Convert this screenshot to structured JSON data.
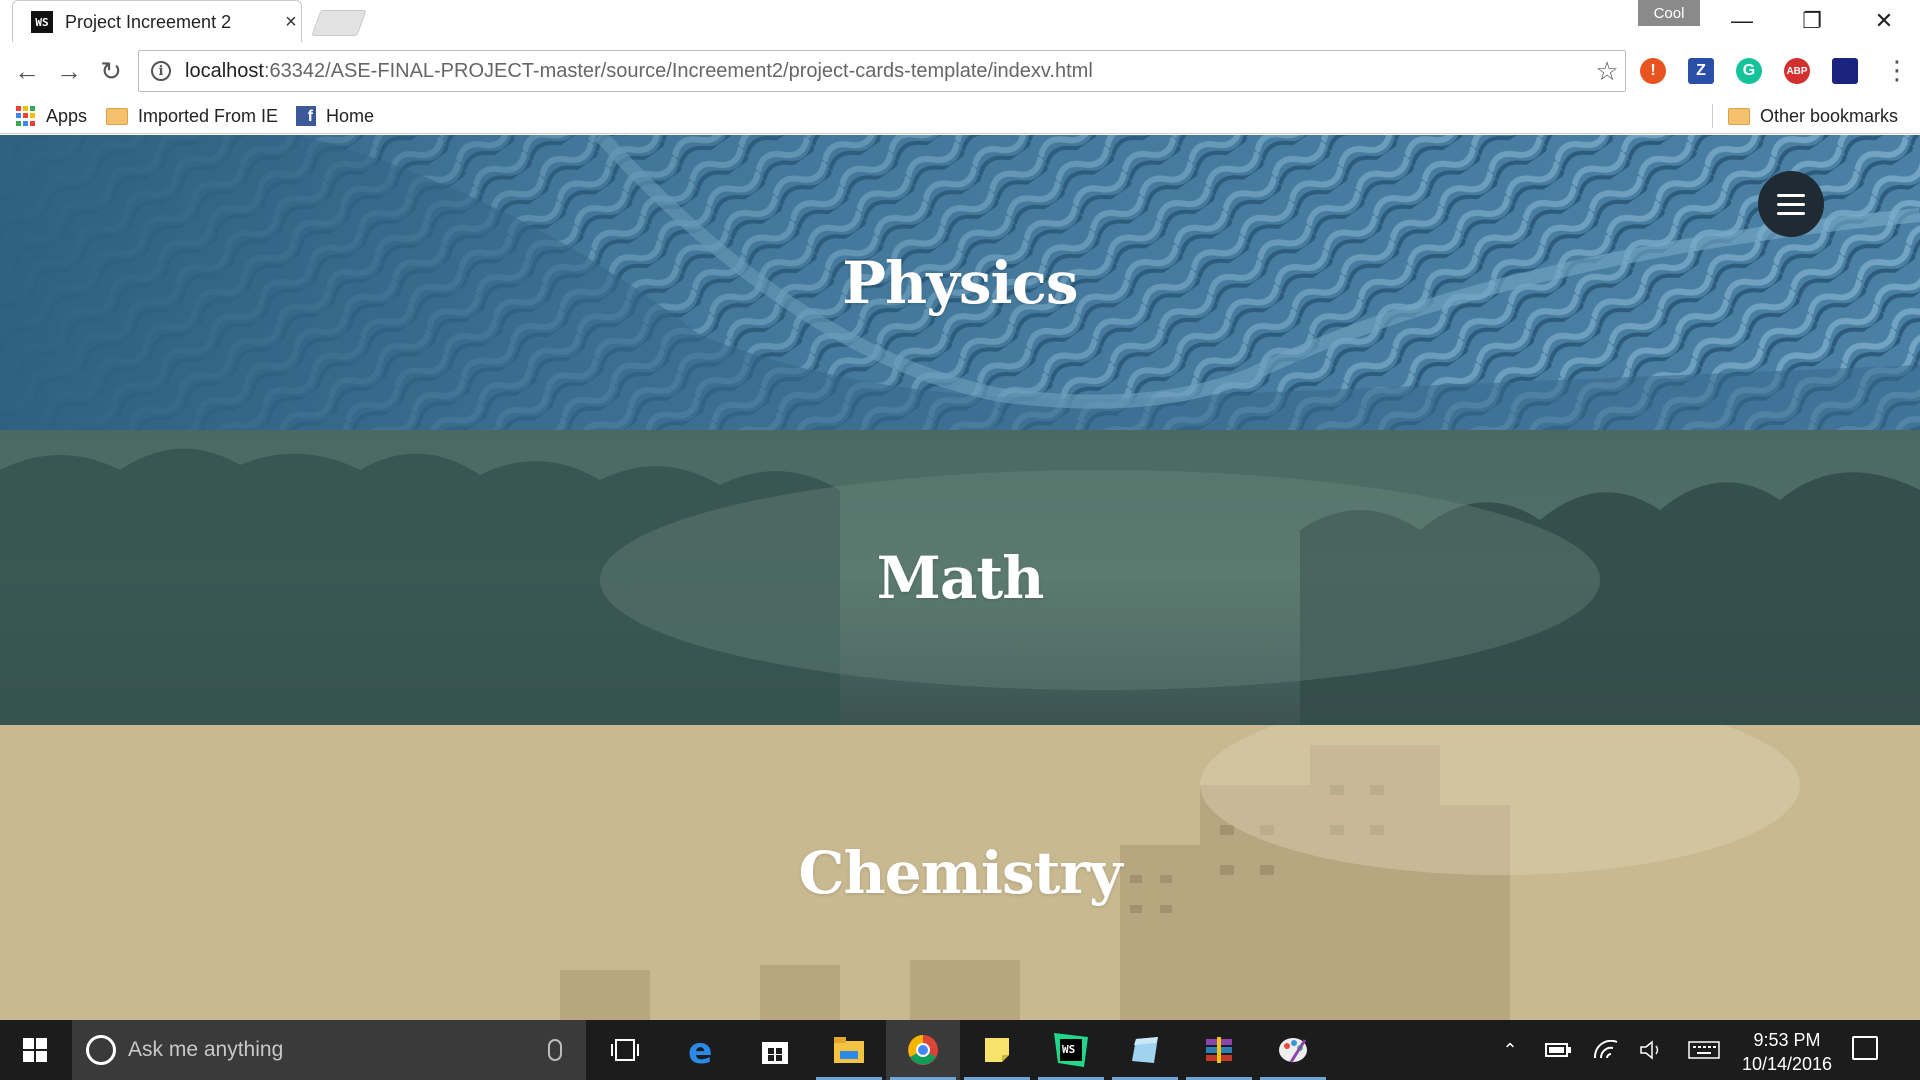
{
  "browser": {
    "tab_title": "Project Increement 2",
    "tab_favicon_text": "WS",
    "tab_close": "×",
    "profile_name": "Cool",
    "url_host": "localhost",
    "url_rest": ":63342/ASE-FINAL-PROJECT-master/source/Increement2/project-cards-template/indexv.html",
    "extensions": [
      {
        "name": "alert-extension-icon",
        "glyph": "!",
        "color": "#e8531f"
      },
      {
        "name": "zotero-extension-icon",
        "glyph": "Z",
        "color": "#2a4fa8"
      },
      {
        "name": "grammarly-extension-icon",
        "glyph": "G",
        "color": "#15c39a"
      },
      {
        "name": "adblock-plus-extension-icon",
        "glyph": "ABP",
        "color": "#d32f2f"
      },
      {
        "name": "flag-extension-icon",
        "glyph": "",
        "color": "#1a237e"
      }
    ]
  },
  "bookmarks": {
    "apps_label": "Apps",
    "imported_label": "Imported From IE",
    "home_label": "Home",
    "other_label": "Other bookmarks"
  },
  "cards": [
    {
      "title": "Physics",
      "color": "#3e7294"
    },
    {
      "title": "Math",
      "color": "#3f5a57"
    },
    {
      "title": "Chemistry",
      "color": "#c9b991"
    }
  ],
  "taskbar": {
    "search_placeholder": "Ask me anything",
    "apps": [
      "task-view",
      "edge",
      "store",
      "file-explorer",
      "chrome",
      "sticky-notes",
      "webstorm",
      "notepad",
      "winrar",
      "paint"
    ],
    "time": "9:53 PM",
    "date": "10/14/2016"
  }
}
